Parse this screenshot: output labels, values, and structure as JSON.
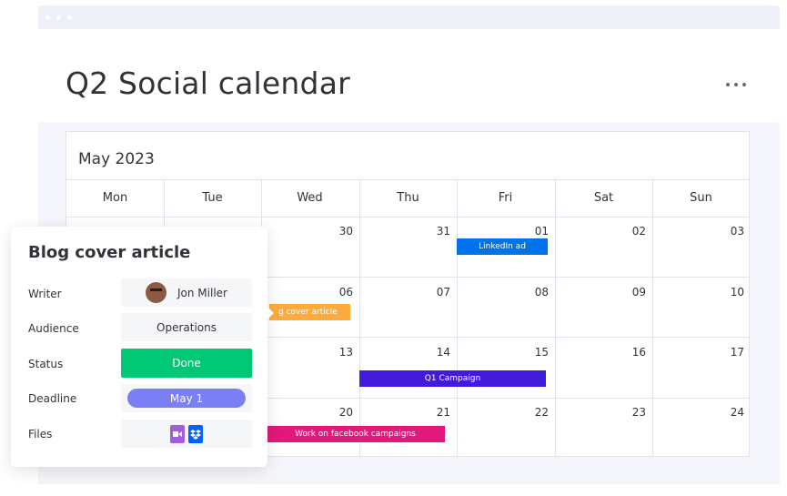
{
  "window": {
    "dots": 3
  },
  "title": "Q2 Social calendar",
  "more_icon": "more-horizontal-icon",
  "calendar": {
    "month": "May 2023",
    "days": [
      "Mon",
      "Tue",
      "Wed",
      "Thu",
      "Fri",
      "Sat",
      "Sun"
    ],
    "weeks": [
      [
        "",
        "",
        "30",
        "31",
        "01",
        "02",
        "03"
      ],
      [
        "",
        "",
        "06",
        "07",
        "08",
        "09",
        "10"
      ],
      [
        "",
        "",
        "13",
        "14",
        "15",
        "16",
        "17"
      ],
      [
        "",
        "",
        "20",
        "21",
        "22",
        "23",
        "24"
      ]
    ],
    "events": [
      {
        "label": "LinkedIn ad",
        "color": "#0073ea"
      },
      {
        "label": "Blog cover article",
        "visible_text": "g cover article",
        "color": "#fdab3d"
      },
      {
        "label": "Q1 Campaign",
        "color": "#401bd9"
      },
      {
        "label": "Work on facebook campaigns",
        "color": "#e2197a"
      }
    ]
  },
  "card": {
    "title": "Blog cover article",
    "rows": {
      "writer": {
        "label": "Writer",
        "value": "Jon Miller"
      },
      "audience": {
        "label": "Audience",
        "value": "Operations"
      },
      "status": {
        "label": "Status",
        "value": "Done",
        "color": "#00c875"
      },
      "deadline": {
        "label": "Deadline",
        "value": "May 1",
        "color": "#7b7ff5"
      },
      "files": {
        "label": "Files",
        "icons": [
          "video-file-icon",
          "dropbox-icon"
        ]
      }
    }
  }
}
